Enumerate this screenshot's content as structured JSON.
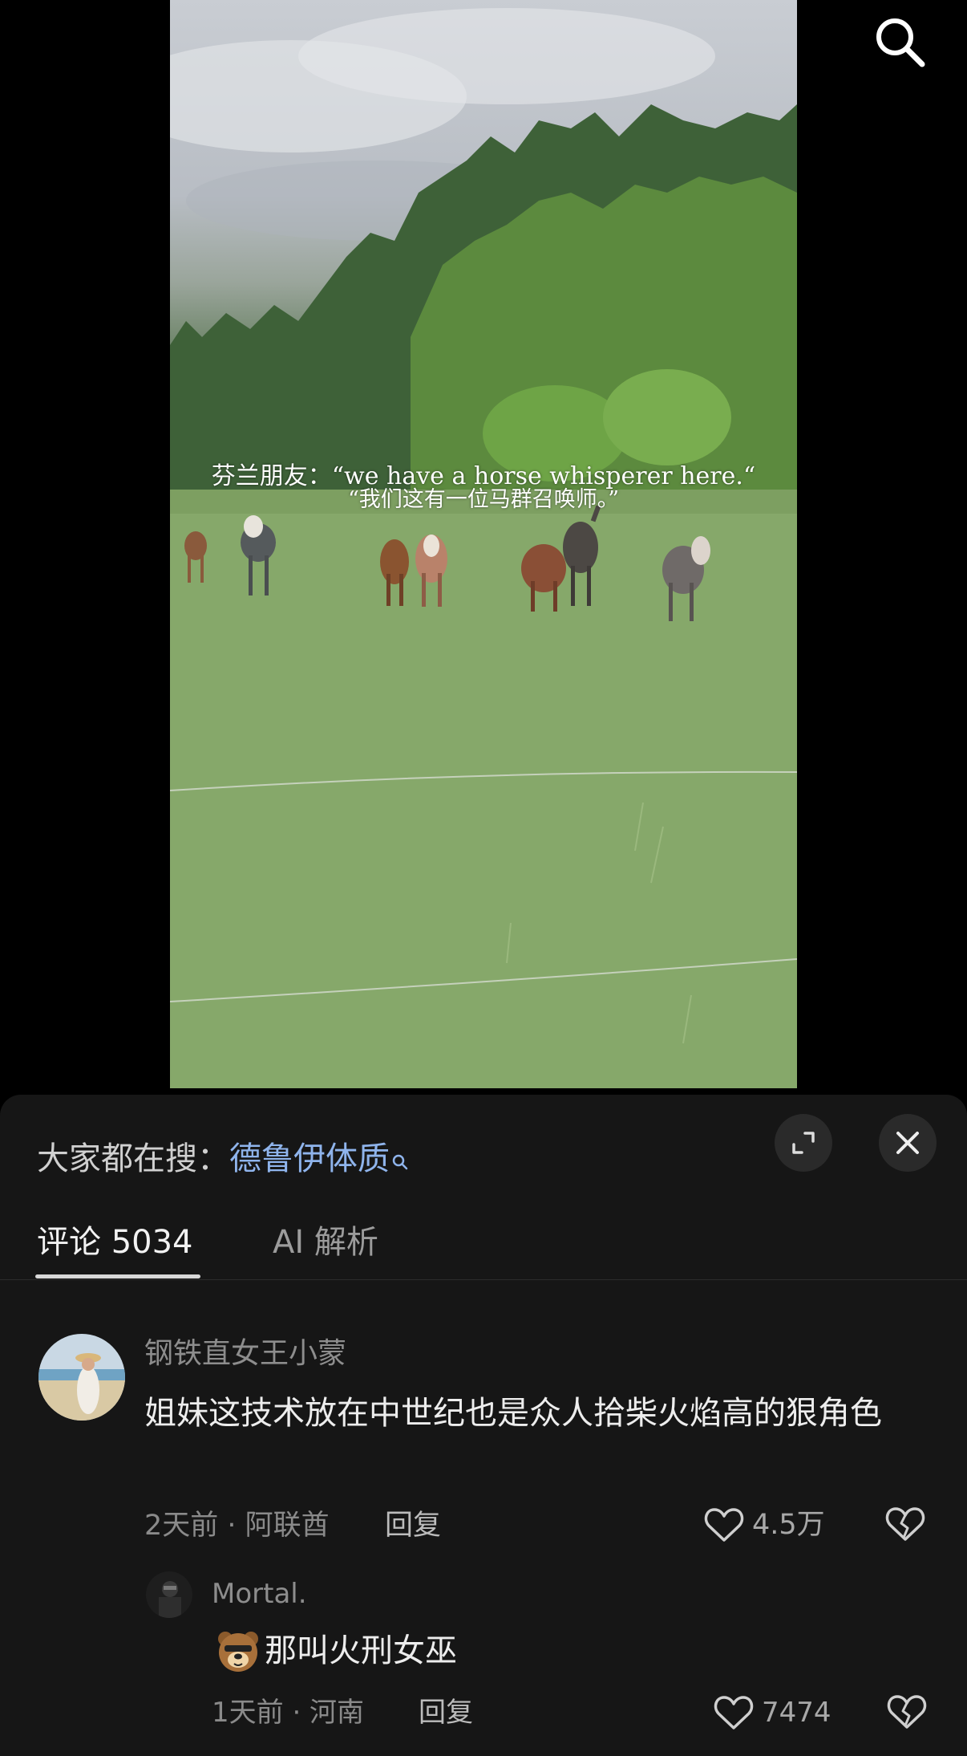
{
  "video": {
    "subtitle_line1": "芬兰朋友：“we have a horse whisperer here.“",
    "subtitle_line2": "“我们这有一位马群召唤师。”"
  },
  "top_bar": {
    "search_icon": "search-icon"
  },
  "panel": {
    "hot_search_prefix": "大家都在搜：",
    "hot_search_term": "德鲁伊体质",
    "expand_icon": "expand-icon",
    "close_icon": "close-icon"
  },
  "tabs": [
    {
      "label": "评论 5034",
      "active": true
    },
    {
      "label": "AI 解析",
      "active": false
    }
  ],
  "comments": [
    {
      "user": "钢铁直女王小蒙",
      "text": "姐妹这技术放在中世纪也是众人拾柴火焰高的狠角色",
      "meta": "2天前 · 阿联酋",
      "reply_label": "回复",
      "likes": "4.5万",
      "replies": [
        {
          "user": "Mortal.",
          "emoji": "bear-face",
          "text": "那叫火刑女巫",
          "meta": "1天前 · 河南",
          "reply_label": "回复",
          "likes": "7474"
        }
      ]
    }
  ],
  "colors": {
    "accent_link": "#8fb4ec",
    "panel_bg": "#161616",
    "page_bg": "#000000"
  }
}
